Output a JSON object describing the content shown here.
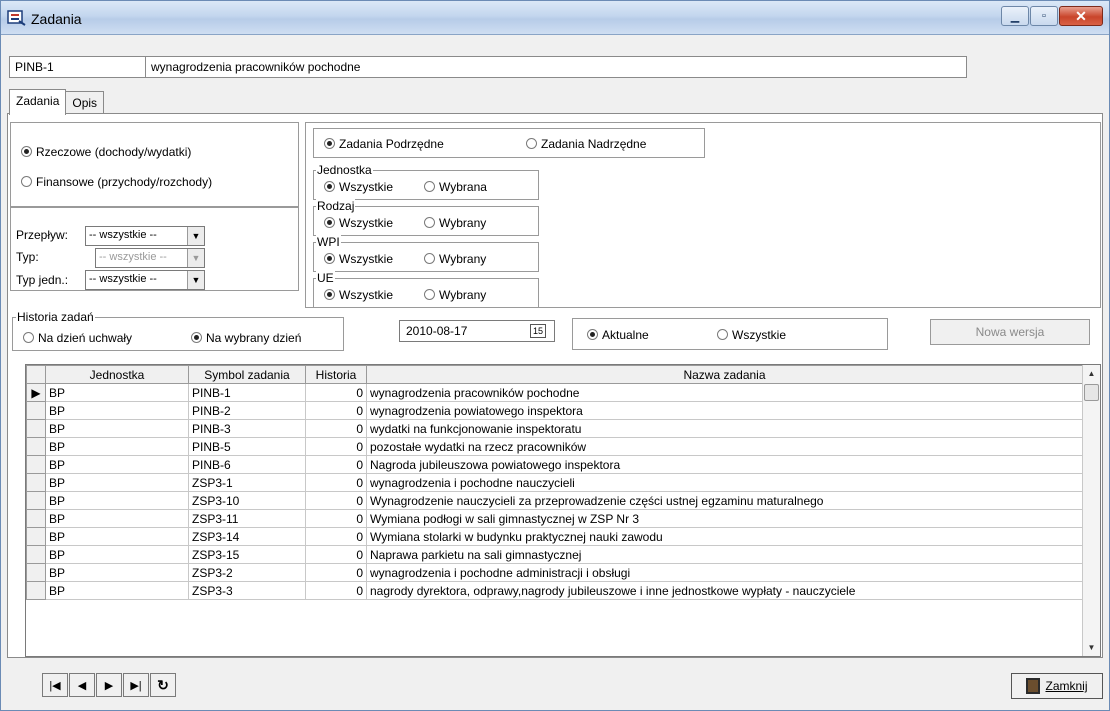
{
  "window": {
    "title": "Zadania"
  },
  "header": {
    "code": "PINB-1",
    "name": "wynagrodzenia pracowników  pochodne"
  },
  "tabs": [
    {
      "label": "Zadania"
    },
    {
      "label": "Opis"
    }
  ],
  "type_group": {
    "options": [
      {
        "label": "Rzeczowe (dochody/wydatki)",
        "selected": true
      },
      {
        "label": "Finansowe (przychody/rozchody)",
        "selected": false
      }
    ]
  },
  "filters": {
    "przeplyw": {
      "label": "Przepływ:",
      "value": "-- wszystkie --"
    },
    "typ": {
      "label": "Typ:",
      "value": "-- wszystkie --"
    },
    "typ_jedn": {
      "label": "Typ jedn.:",
      "value": "-- wszystkie --"
    }
  },
  "hierarchy": {
    "options": [
      {
        "label": "Zadania Podrzędne",
        "selected": true
      },
      {
        "label": "Zadania Nadrzędne",
        "selected": false
      }
    ]
  },
  "jednostka": {
    "caption": "Jednostka",
    "opt1": "Wszystkie",
    "opt2": "Wybrana"
  },
  "rodzaj": {
    "caption": "Rodzaj",
    "opt1": "Wszystkie",
    "opt2": "Wybrany"
  },
  "wpi": {
    "caption": "WPI",
    "opt1": "Wszystkie",
    "opt2": "Wybrany"
  },
  "ue": {
    "caption": "UE",
    "opt1": "Wszystkie",
    "opt2": "Wybrany"
  },
  "historia": {
    "caption": "Historia zadań",
    "opt1": "Na dzień uchwały",
    "opt2": "Na wybrany dzień",
    "date": "2010-08-17",
    "calendar_glyph": "15"
  },
  "state": {
    "opt1": "Aktualne",
    "opt2": "Wszystkie"
  },
  "buttons": {
    "nowa_wersja": "Nowa wersja",
    "zamknij": "Zamknij"
  },
  "table": {
    "columns": [
      "Jednostka",
      "Symbol zadania",
      "Historia",
      "Nazwa zadania"
    ],
    "rows": [
      [
        "BP",
        "PINB-1",
        "0",
        "wynagrodzenia pracowników  pochodne"
      ],
      [
        "BP",
        "PINB-2",
        "0",
        "wynagrodzenia powiatowego inspektora"
      ],
      [
        "BP",
        "PINB-3",
        "0",
        "wydatki na funkcjonowanie inspektoratu"
      ],
      [
        "BP",
        "PINB-5",
        "0",
        "pozostałe wydatki na rzecz pracowników"
      ],
      [
        "BP",
        "PINB-6",
        "0",
        "Nagroda jubileuszowa powiatowego inspektora"
      ],
      [
        "BP",
        "ZSP3-1",
        "0",
        "wynagrodzenia i pochodne nauczycieli"
      ],
      [
        "BP",
        "ZSP3-10",
        "0",
        "Wynagrodzenie nauczycieli za przeprowadzenie części ustnej egzaminu maturalnego"
      ],
      [
        "BP",
        "ZSP3-11",
        "0",
        "Wymiana podłogi w sali gimnastycznej w ZSP Nr 3"
      ],
      [
        "BP",
        "ZSP3-14",
        "0",
        "Wymiana stolarki w budynku praktycznej nauki zawodu"
      ],
      [
        "BP",
        "ZSP3-15",
        "0",
        "Naprawa parkietu na sali gimnastycznej"
      ],
      [
        "BP",
        "ZSP3-2",
        "0",
        "wynagrodzenia i pochodne administracji i obsługi"
      ],
      [
        "BP",
        "ZSP3-3",
        "0",
        "nagrody dyrektora, odprawy,nagrody jubileuszowe i inne jednostkowe wypłaty - nauczyciele"
      ]
    ]
  }
}
